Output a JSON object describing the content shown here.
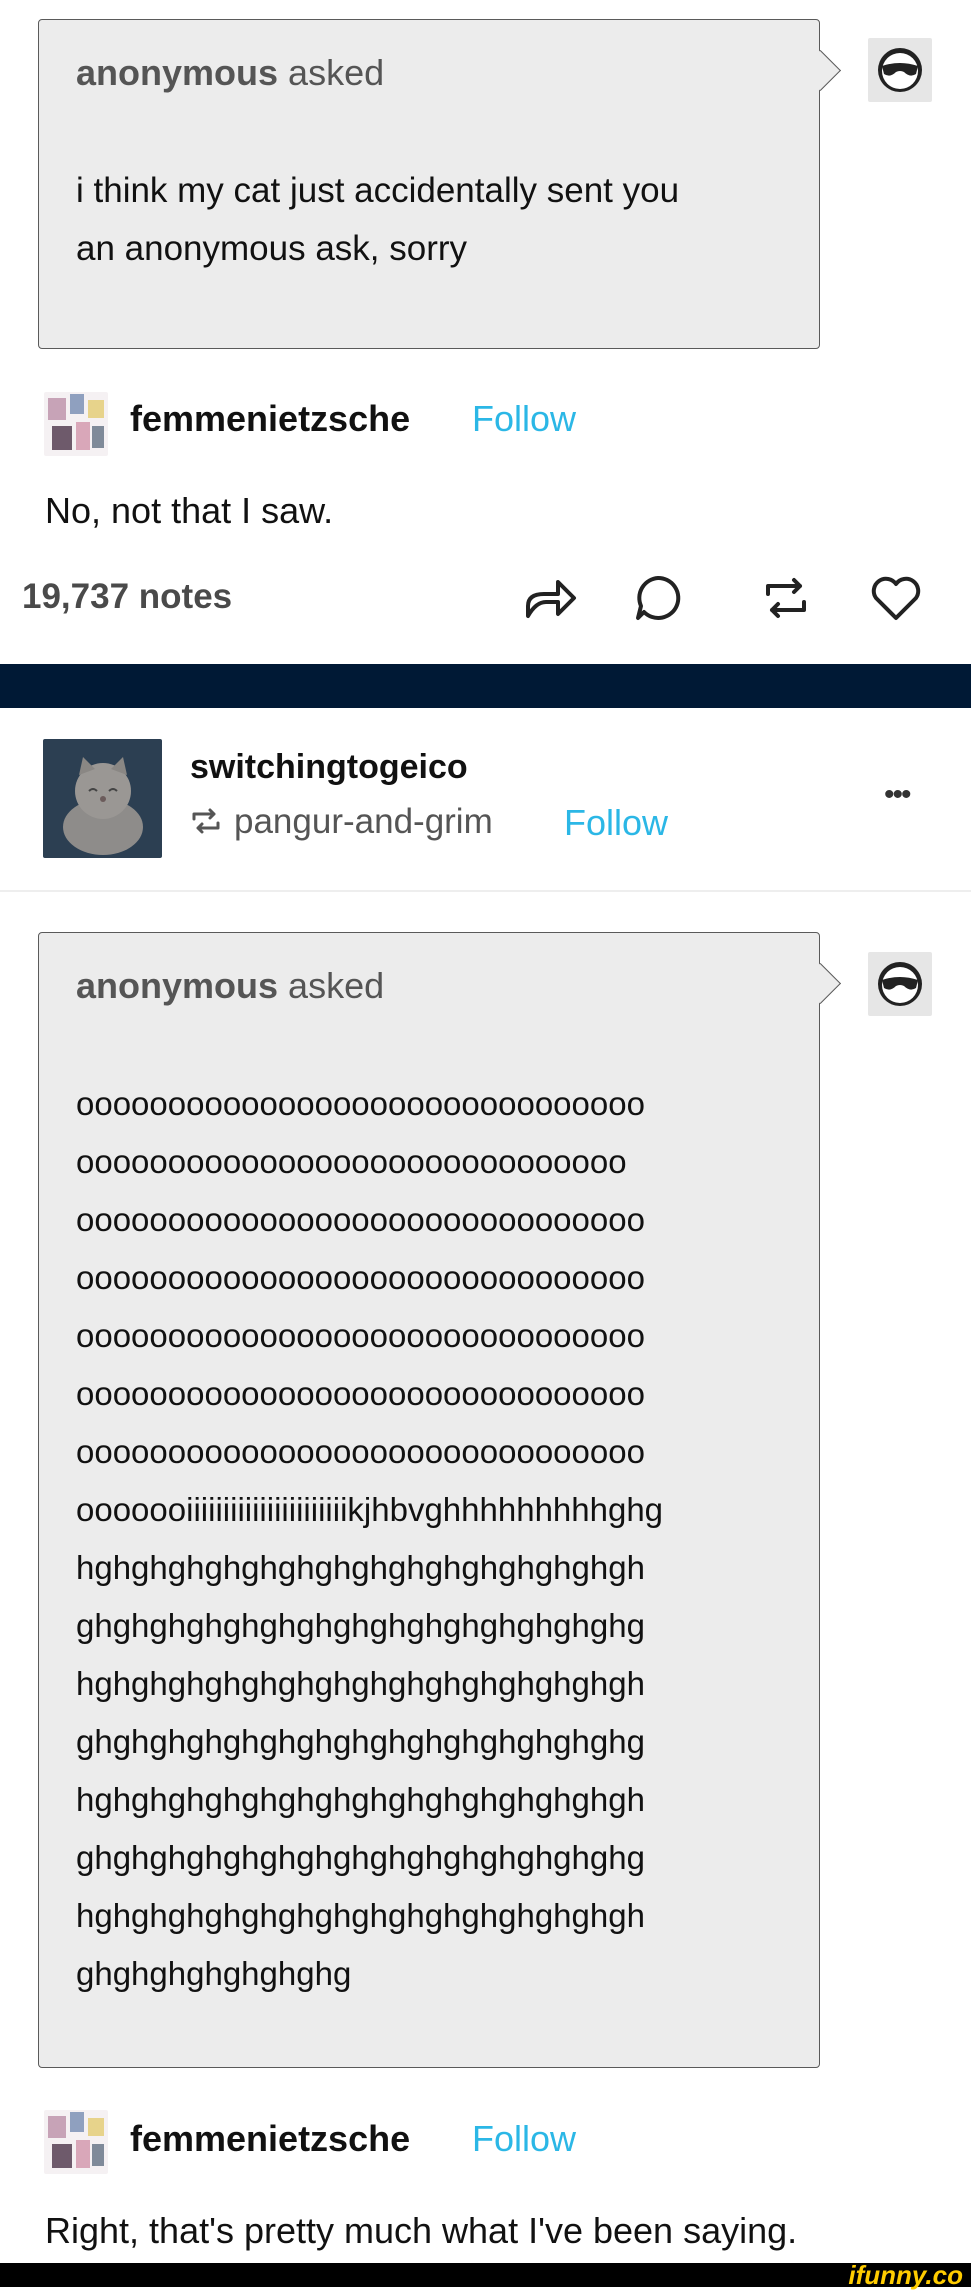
{
  "post1": {
    "ask": {
      "asker_name": "anonymous",
      "asker_verb": "asked",
      "lines": [
        "i think my cat just accidentally sent you",
        "an anonymous ask, sorry"
      ]
    },
    "answerer": {
      "name": "femmenietzsche",
      "follow_label": "Follow"
    },
    "reply": "No, not that I saw.",
    "notes": "19,737 notes"
  },
  "post2": {
    "header": {
      "blog_name": "switchingtogeico",
      "reblogged_from": "pangur-and-grim",
      "follow_label": "Follow",
      "more_label": "•••"
    },
    "ask": {
      "asker_name": "anonymous",
      "asker_verb": "asked",
      "lines": [
        "ooooooooooooooooooooooooooooooo",
        "oooooooooooooooooooooooooooooo",
        "ooooooooooooooooooooooooooooooo",
        "ooooooooooooooooooooooooooooooo",
        "ooooooooooooooooooooooooooooooo",
        "ooooooooooooooooooooooooooooooo",
        "ooooooooooooooooooooooooooooooo",
        "ooooooiiiiiiiiiiiiiiiiiiiiiikjhbvghhhhhhhhhghg",
        "hghghghghghghghghghghghghghghgh",
        "ghghghghghghghghghghghghghghghg",
        "hghghghghghghghghghghghghghghgh",
        "ghghghghghghghghghghghghghghghg",
        "hghghghghghghghghghghghghghghgh",
        "ghghghghghghghghghghghghghghghg",
        "hghghghghghghghghghghghghghghgh",
        "ghghghghghghghg"
      ]
    },
    "answerer": {
      "name": "femmenietzsche",
      "follow_label": "Follow"
    },
    "reply": "Right, that's pretty much what I've been saying."
  },
  "watermark": "ifunny.co",
  "colors": {
    "follow": "#2bb7e6",
    "navy_bar": "#001935",
    "ask_bg": "#ececec"
  }
}
